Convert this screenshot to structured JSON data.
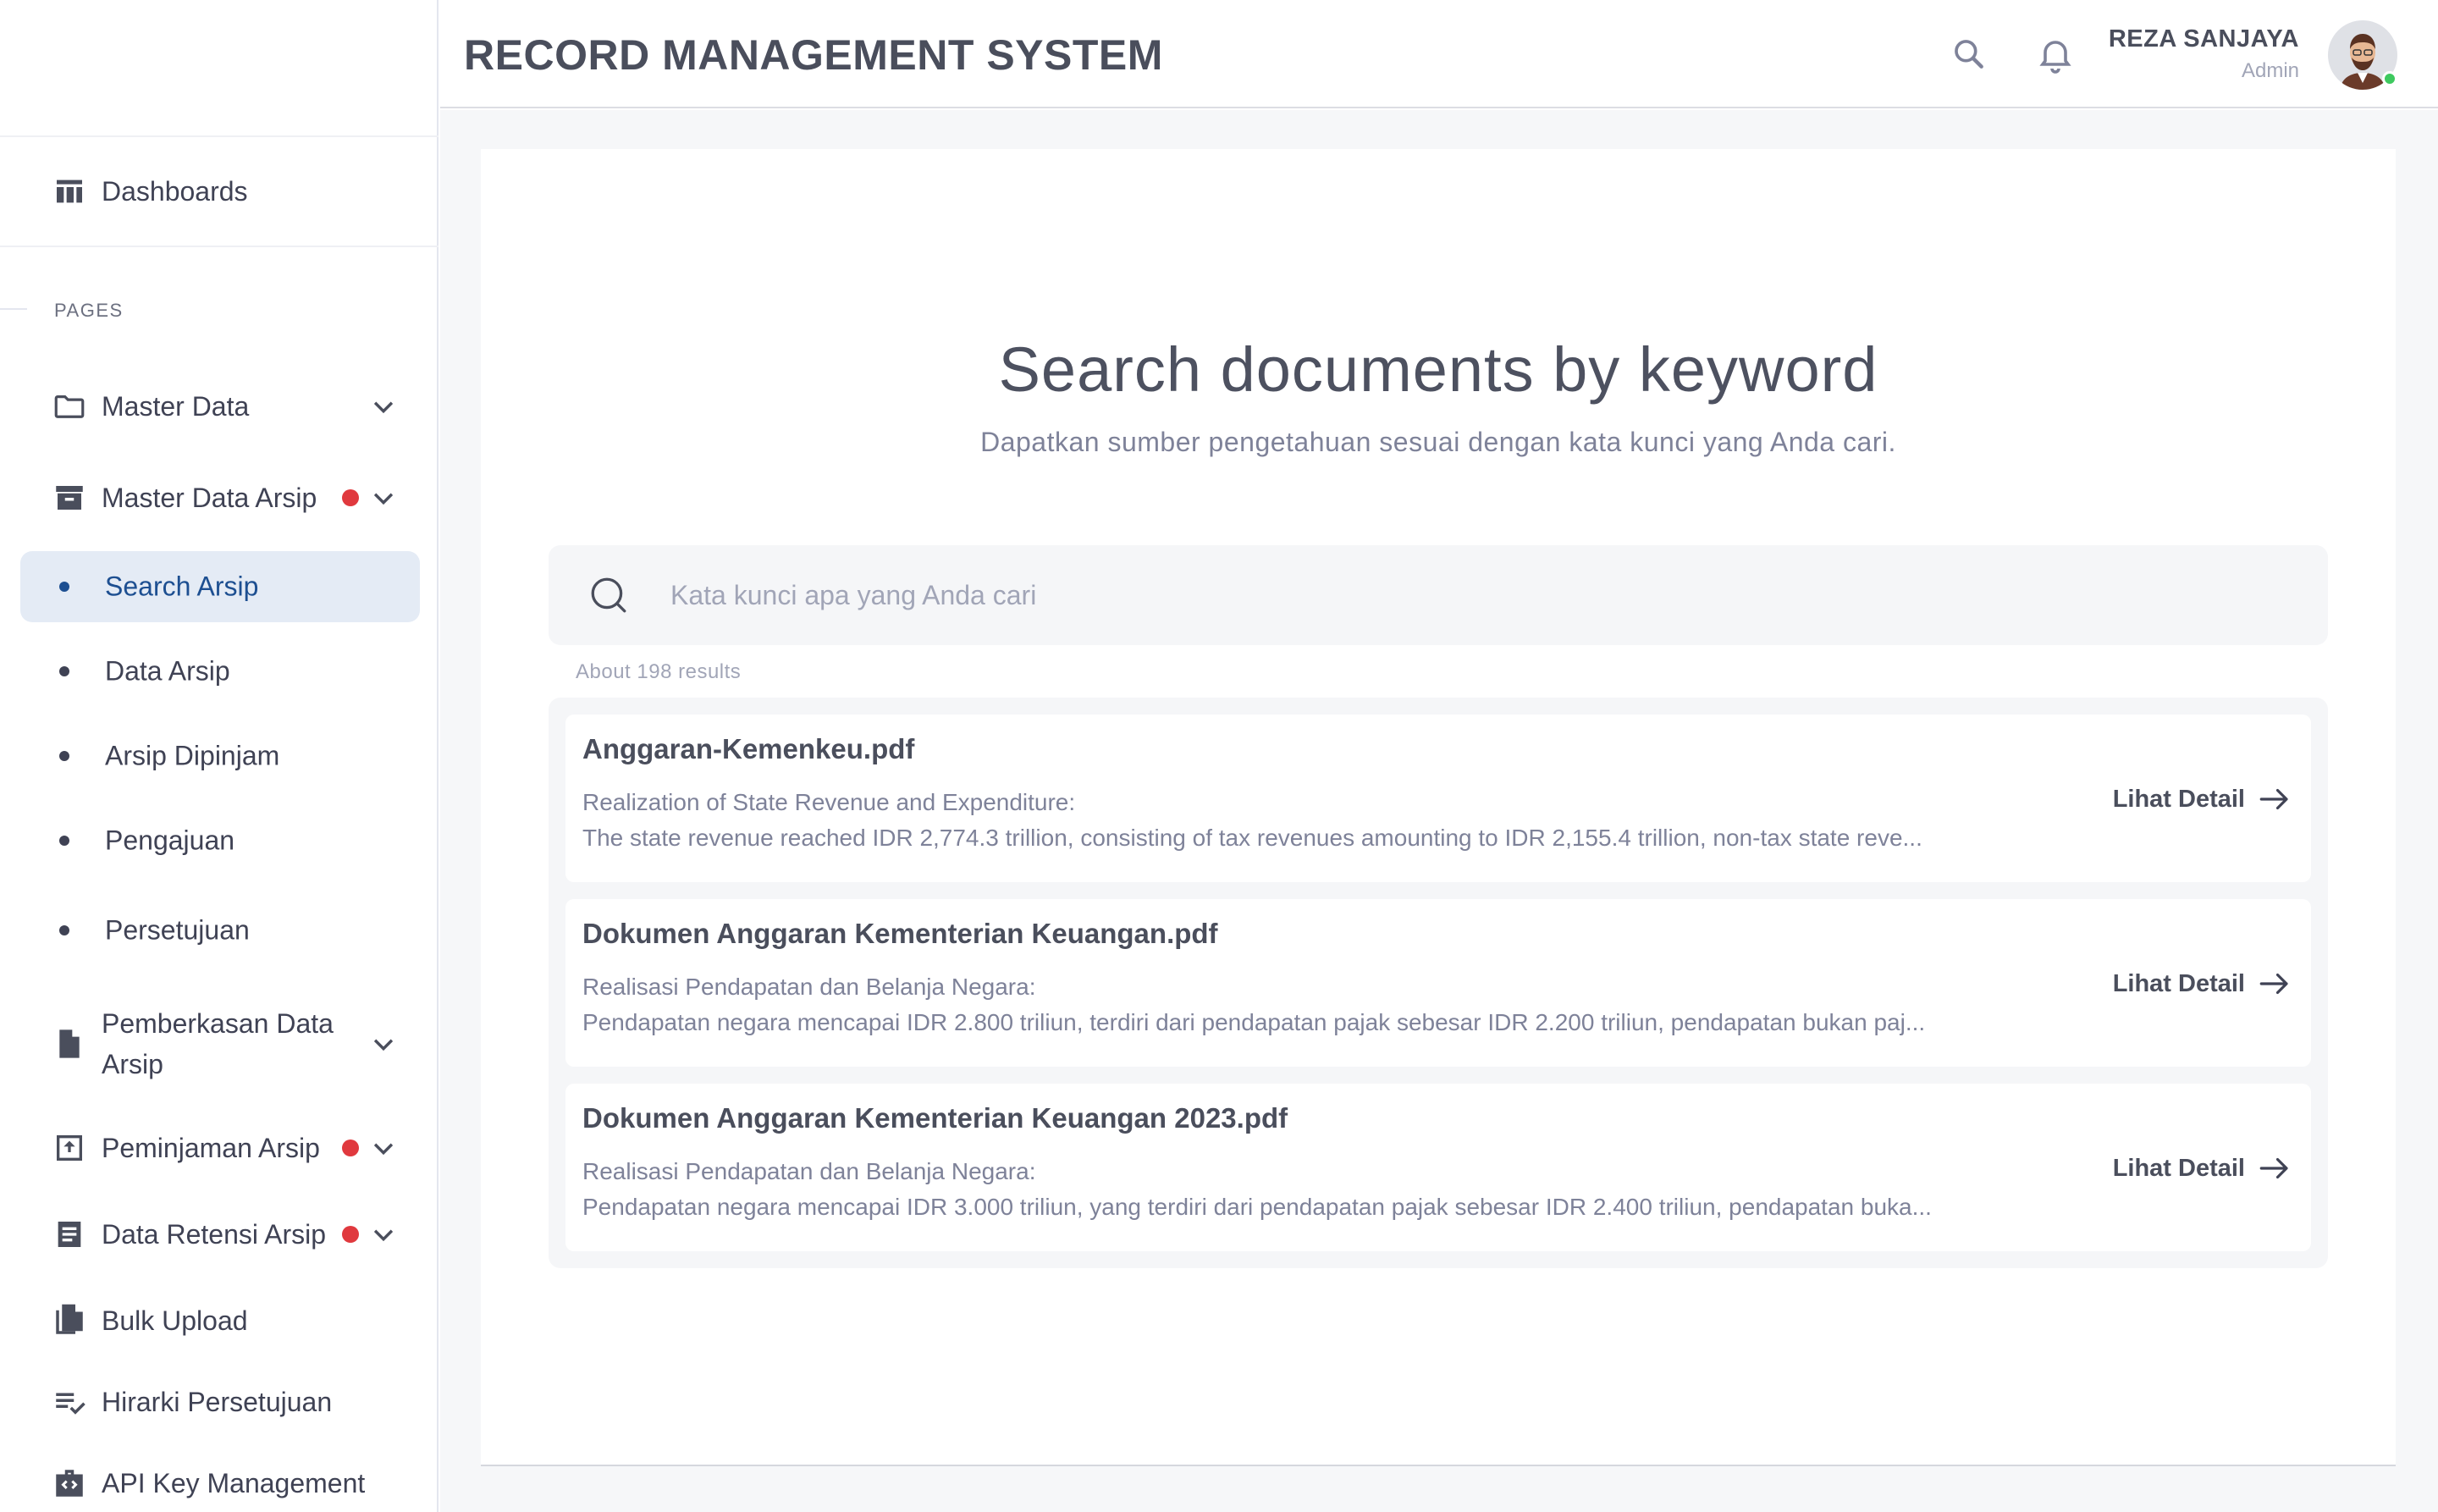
{
  "header": {
    "app_title": "RECORD MANAGEMENT SYSTEM",
    "user": {
      "name": "REZA SANJAYA",
      "role": "Admin"
    },
    "icons": [
      "search-icon",
      "bell-icon"
    ]
  },
  "sidebar": {
    "dashboards": "Dashboards",
    "section_label": "PAGES",
    "items": {
      "master_data": "Master Data",
      "master_data_arsip": "Master Data Arsip",
      "pemberkasan": "Pemberkasan Data Arsip",
      "peminjaman": "Peminjaman Arsip",
      "retensi": "Data Retensi Arsip",
      "bulk_upload": "Bulk Upload",
      "hirarki": "Hirarki Persetujuan",
      "api_key": "API Key Management"
    },
    "sub_items": {
      "search_arsip": "Search Arsip",
      "data_arsip": "Data Arsip",
      "arsip_dipinjam": "Arsip Dipinjam",
      "pengajuan": "Pengajuan",
      "persetujuan": "Persetujuan"
    },
    "active": "Search Arsip"
  },
  "main": {
    "title": "Search documents by keyword",
    "subtitle": "Dapatkan sumber pengetahuan sesuai dengan kata kunci yang Anda cari.",
    "search": {
      "value": "",
      "placeholder": "Kata kunci apa yang Anda cari"
    },
    "results_count": "About 198 results",
    "results": [
      {
        "title": "Anggaran-Kemenkeu.pdf",
        "line1": "Realization of State Revenue and Expenditure:",
        "line2": "The state revenue reached IDR 2,774.3 trillion, consisting of tax revenues amounting to IDR 2,155.4 trillion, non-tax state reve...",
        "link": "Lihat Detail"
      },
      {
        "title": "Dokumen Anggaran Kementerian Keuangan.pdf",
        "line1": "Realisasi Pendapatan dan Belanja Negara:",
        "line2": "Pendapatan negara mencapai IDR 2.800 triliun, terdiri dari pendapatan pajak sebesar IDR 2.200 triliun, pendapatan bukan paj...",
        "link": "Lihat Detail"
      },
      {
        "title": "Dokumen Anggaran Kementerian Keuangan 2023.pdf",
        "line1": "Realisasi Pendapatan dan Belanja Negara:",
        "line2": "Pendapatan negara mencapai IDR 3.000 triliun, yang terdiri dari pendapatan pajak sebesar IDR 2.400 triliun, pendapatan buka...",
        "link": "Lihat Detail"
      }
    ]
  },
  "colors": {
    "active_text": "#1d4f91",
    "active_bg": "#e4ebf5",
    "badge_red": "#e0393e",
    "online_green": "#3ec95f"
  }
}
